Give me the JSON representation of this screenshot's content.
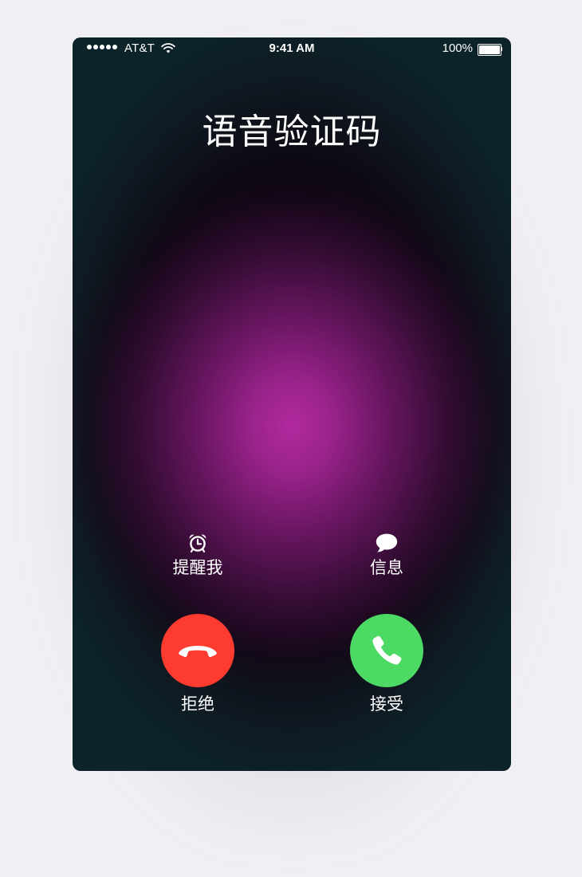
{
  "status_bar": {
    "carrier": "AT&T",
    "time": "9:41 AM",
    "battery_percent": "100%",
    "signal_bars": 5,
    "battery_level": 1.0
  },
  "call": {
    "caller_name": "语音验证码"
  },
  "actions": {
    "remind_label": "提醒我",
    "remind_icon": "alarm-clock-icon",
    "message_label": "信息",
    "message_icon": "speech-bubble-icon",
    "decline_label": "拒绝",
    "accept_label": "接受"
  },
  "colors": {
    "decline": "#fe3b30",
    "accept": "#4cd964",
    "glow": "#b22a9e"
  }
}
